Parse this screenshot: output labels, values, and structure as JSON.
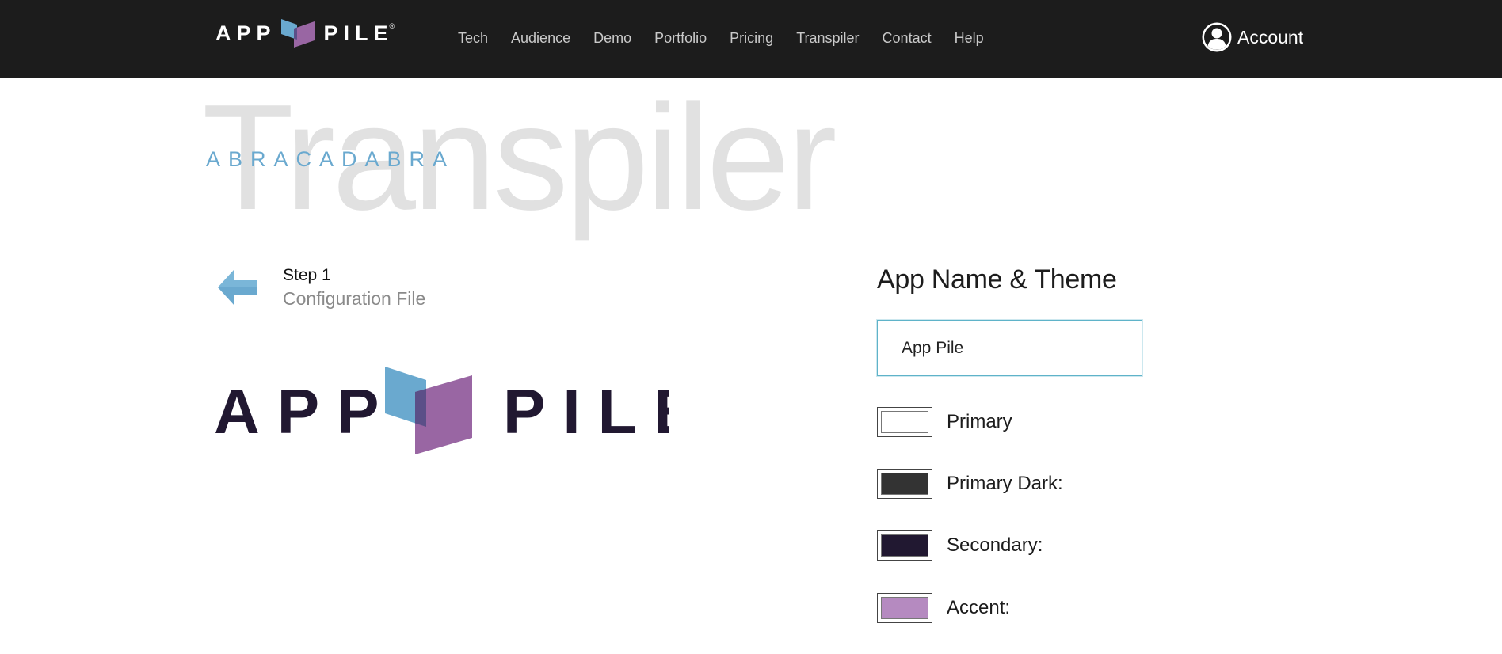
{
  "header": {
    "brand": {
      "left_word": "APP",
      "right_word": "PILE",
      "registered_mark": "®",
      "icon": "app-pile-cube-logo"
    },
    "nav_items": [
      "Tech",
      "Audience",
      "Demo",
      "Portfolio",
      "Pricing",
      "Transpiler",
      "Contact",
      "Help"
    ],
    "account": {
      "label": "Account",
      "icon": "user-circle-icon"
    }
  },
  "hero": {
    "background_word": "Transpiler",
    "kicker": "ABRACADABRA"
  },
  "step": {
    "back_icon": "arrow-left-icon",
    "title": "Step 1",
    "subtitle": "Configuration File"
  },
  "logo_preview": {
    "left_word": "APP",
    "right_word": "PILE"
  },
  "theme_panel": {
    "title": "App Name & Theme",
    "app_name_value": "App Pile",
    "swatches": [
      {
        "label": "Primary",
        "color": "#ffffff"
      },
      {
        "label": "Primary Dark:",
        "color": "#333333"
      },
      {
        "label": "Secondary:",
        "color": "#211831"
      },
      {
        "label": "Accent:",
        "color": "#b58ac0"
      }
    ]
  },
  "colors": {
    "header_bg": "#1c1c1c",
    "brand_blue": "#6aa9cf",
    "brand_purple": "#9966a3",
    "brand_dark": "#211831"
  }
}
